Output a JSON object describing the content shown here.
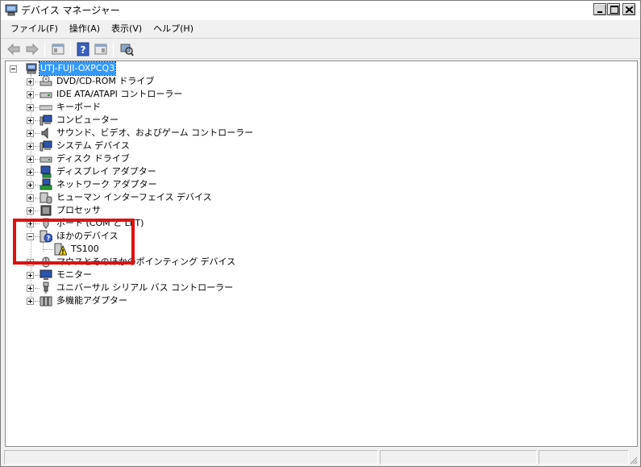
{
  "window": {
    "title": "デバイス マネージャー"
  },
  "menubar": {
    "items": [
      "ファイル(F)",
      "操作(A)",
      "表示(V)",
      "ヘルプ(H)"
    ]
  },
  "toolbar": {
    "buttons": [
      "back-arrow-icon",
      "forward-arrow-icon",
      "properties-icon",
      "help-icon",
      "view-icon",
      "scan-hardware-icon"
    ]
  },
  "tree": {
    "root": "UTJ-FUJI-OXPCQ3",
    "items": [
      "DVD/CD-ROM ドライブ",
      "IDE ATA/ATAPI コントローラー",
      "キーボード",
      "コンピューター",
      "サウンド、ビデオ、およびゲーム コントローラー",
      "システム デバイス",
      "ディスク ドライブ",
      "ディスプレイ アダプター",
      "ネットワーク アダプター",
      "ヒューマン インターフェイス デバイス",
      "プロセッサ",
      "ポート (COM と LPT)",
      "ほかのデバイス",
      "TS100",
      "マウスとそのほかのポインティング デバイス",
      "モニター",
      "ユニバーサル シリアル バス コントローラー",
      "多機能アダプター"
    ]
  },
  "colors": {
    "selection": "#3399ff",
    "highlight_box": "#e01010"
  }
}
